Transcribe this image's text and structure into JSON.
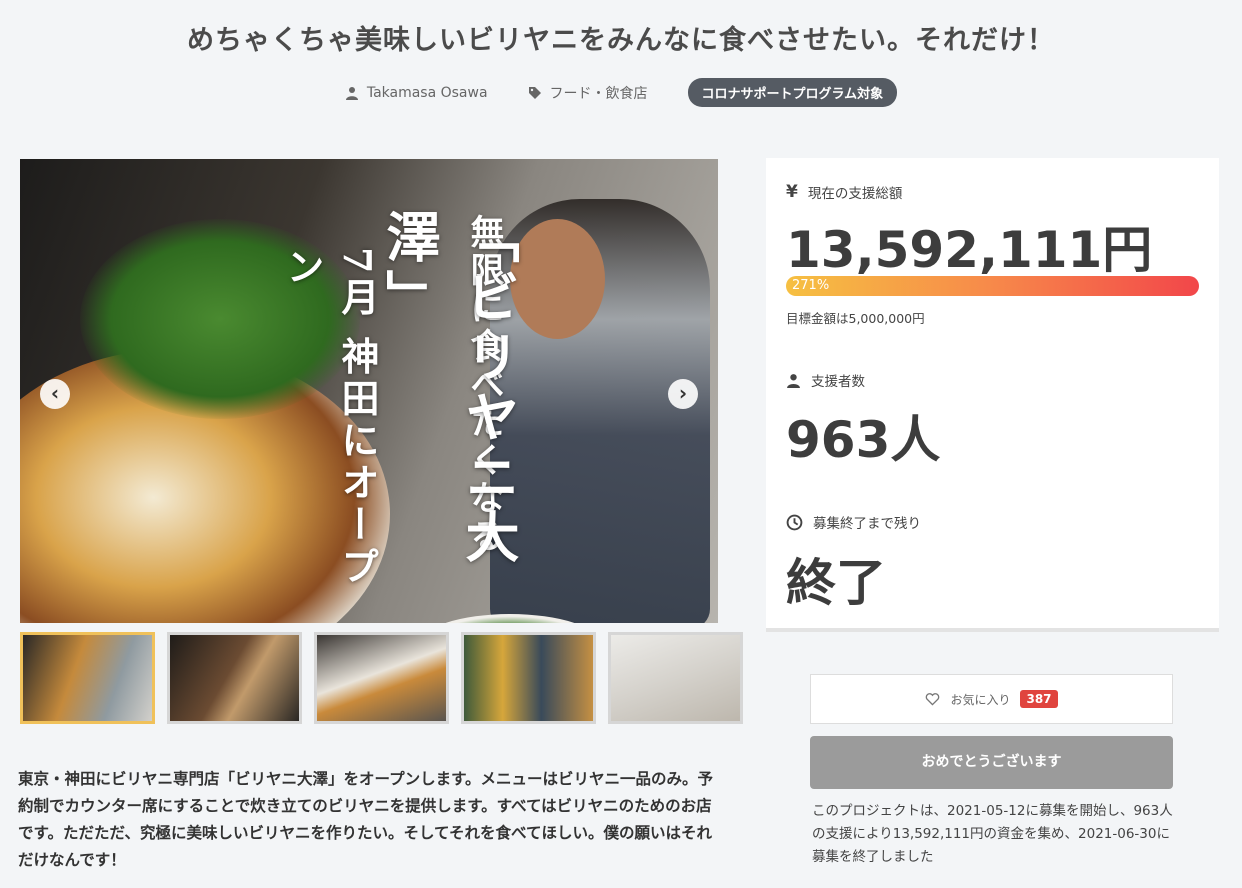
{
  "title": "めちゃくちゃ美味しいビリヤニをみんなに食べさせたい。それだけ！",
  "meta": {
    "author": "Takamasa Osawa",
    "category": "フード・飲食店",
    "badge": "コロナサポートプログラム対象"
  },
  "hero": {
    "text_open": "7月 神田にオープン",
    "text_shop": "「ビリヤニ大澤」",
    "text_tagline": "無限に食べたくなる",
    "prev_arrow": "‹",
    "next_arrow": "›"
  },
  "thumbnails": [
    "thumb-1",
    "thumb-2",
    "thumb-3",
    "thumb-4",
    "thumb-5"
  ],
  "description": "東京・神田にビリヤニ専門店「ビリヤニ大澤」をオープンします。メニューはビリヤニ一品のみ。予約制でカウンター席にすることで炊き立てのビリヤニを提供します。すべてはビリヤニのためのお店です。ただただ、究極に美味しいビリヤニを作りたい。そしてそれを食べてほしい。僕の願いはそれだけなんです！",
  "stats": {
    "total_label": "現在の支援総額",
    "total_value": "13,592,111円",
    "progress_percent": "271%",
    "progress_fraction": 1.0,
    "goal": "目標金額は5,000,000円",
    "supporters_label": "支援者数",
    "supporters_value": "963人",
    "remaining_label": "募集終了まで残り",
    "remaining_value": "終了"
  },
  "favorite": {
    "label": "お気に入り",
    "count": "387"
  },
  "congrats_button": "おめでとうございます",
  "summary": "このプロジェクトは、2021-05-12に募集を開始し、963人の支援により13,592,111円の資金を集め、2021-06-30に募集を終了しました",
  "colors": {
    "progress_start": "#f6c042",
    "progress_end": "#f2464a",
    "badge": "#555b63",
    "fav_count": "#e0443e"
  }
}
